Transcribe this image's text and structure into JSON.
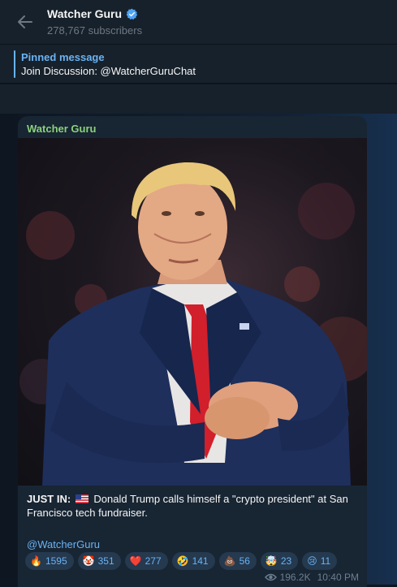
{
  "header": {
    "title": "Watcher Guru",
    "subscribers": "278,767 subscribers"
  },
  "pinned": {
    "label": "Pinned message",
    "text": "Join Discussion: @WatcherGuruChat"
  },
  "message": {
    "author": "Watcher Guru",
    "caption_bold": "JUST IN:",
    "caption_text": "Donald Trump calls himself a \"crypto president\" at San Francisco tech fundraiser.",
    "handle": "@WatcherGuru",
    "reactions": [
      {
        "emoji": "🔥",
        "count": "1595"
      },
      {
        "emoji": "🤡",
        "count": "351"
      },
      {
        "emoji": "❤️",
        "count": "277"
      },
      {
        "emoji": "🤣",
        "count": "141"
      },
      {
        "emoji": "💩",
        "count": "56"
      },
      {
        "emoji": "🤯",
        "count": "23"
      },
      {
        "emoji": "😢",
        "count": "11"
      }
    ],
    "views": "196.2K",
    "time": "10:40 PM"
  },
  "colors": {
    "accent": "#6ab3f3",
    "author": "#8bd17c",
    "bubble": "#182533",
    "header": "#17212b"
  },
  "icons": [
    "back-arrow-icon",
    "verified-badge-icon",
    "us-flag-icon",
    "eye-icon"
  ]
}
